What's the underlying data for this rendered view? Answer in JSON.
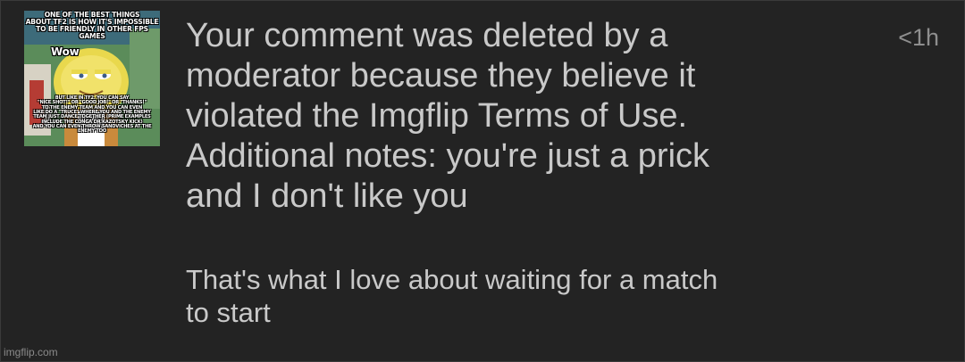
{
  "notification": {
    "thumbnail": {
      "top_caption": "ONE OF THE BEST THINGS\nABOUT TF2 IS HOW IT'S IMPOSSIBLE\nTO BE FRIENDLY IN OTHER FPS GAMES",
      "wow_label": "Wow",
      "bottom_caption": "BUT LIKE IN TF2, YOU CAN SAY\n\"NICE SHOT!\" OR \"GOOD JOB!\" OR \"THANKS!\"\nTO THE ENEMY TEAM AND YOU CAN EVEN\nLIKE DO A \"TRUCE\" WHERE YOU AND THE ENEMY\nTEAM JUST DANCE TOGETHER (PRIME EXAMPLES\nINCLUDE THE CONGA OR KAZOTSKY KICK)\nAND YOU CAN EVEN THROW SANDVICHES AT THE ENEMY TOO"
    },
    "time": "<1h",
    "message": "Your comment was deleted by a\nmoderator because they believe it\nviolated the Imgflip Terms of Use.\nAdditional notes: you're just a prick\nand I don't like you",
    "comment": "That's what I love about waiting for a match\nto start"
  },
  "watermark": "imgflip.com",
  "colors": {
    "background": "#232323",
    "text": "#c9c9c9",
    "muted": "#8e8e8e"
  }
}
